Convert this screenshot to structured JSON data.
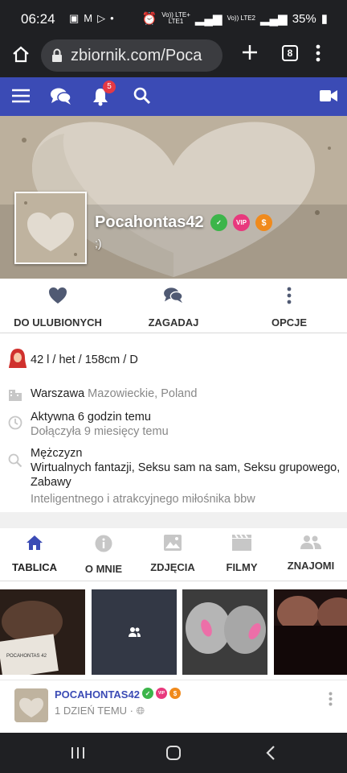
{
  "status_bar": {
    "time": "06:24",
    "sim1": "Vo)) LTE+",
    "sim1b": "LTE1",
    "sim2": "Vo)) LTE2",
    "battery": "35%"
  },
  "browser": {
    "url": "zbiornik.com/Poca",
    "tab_count": "8"
  },
  "navbar": {
    "notification_count": "5"
  },
  "profile": {
    "name": "Pocahontas42",
    "status": ";)",
    "badges": [
      "verified",
      "VIP",
      "$"
    ]
  },
  "actions": {
    "favorite": "DO ULUBIONYCH",
    "ask": "ZAGADAJ",
    "options": "OPCJE"
  },
  "info": {
    "basic": "42 l / het / 158cm / D",
    "city": "Warszawa",
    "region": "Mazowieckie, Poland",
    "active": "Aktywna 6 godzin temu",
    "joined": "Dołączyła 9 miesięcy temu",
    "seeking": "Mężczyzn",
    "interests": "Wirtualnych fantazji, Seksu sam na sam, Seksu grupowego, Zabawy",
    "looking_for": "Inteligentnego i atrakcyjnego miłośnika bbw"
  },
  "tabs": [
    "TABLICA",
    "O MNIE",
    "ZDJĘCIA",
    "FILMY",
    "ZNAJOMI"
  ],
  "thumb_caption": "POCAHONTAS 42",
  "post": {
    "author": "POCAHONTAS42",
    "time": "1 DZIEŃ TEMU ·"
  }
}
